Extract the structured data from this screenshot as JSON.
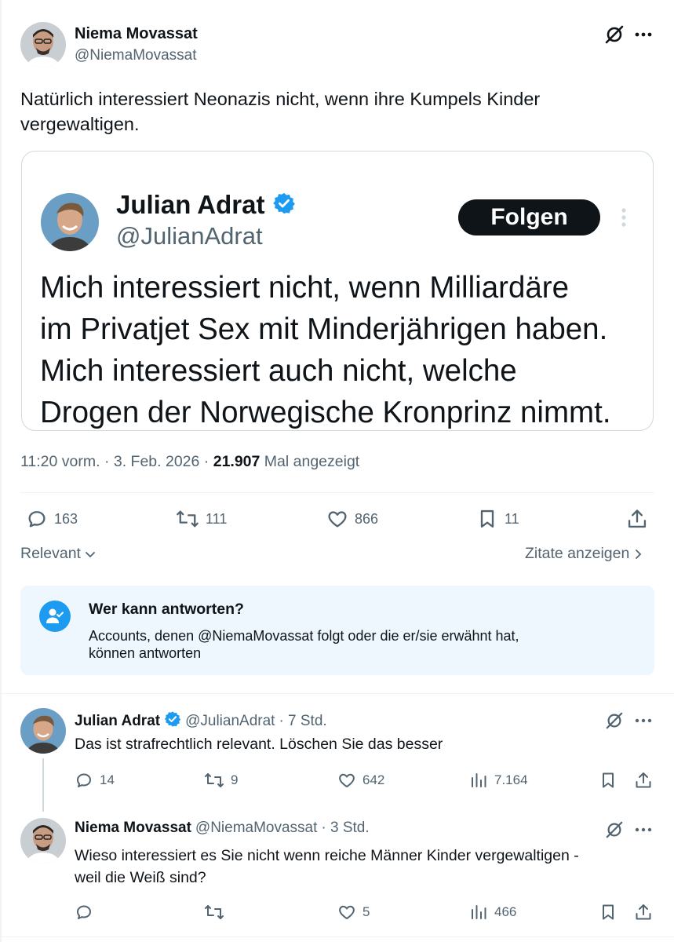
{
  "main_tweet": {
    "author_name": "Niema Movassat",
    "author_handle": "@NiemaMovassat",
    "text_line1": "Natürlich interessiert Neonazis nicht, wenn ihre Kumpels Kinder",
    "text_line2": "vergewaltigen.",
    "time": "11:20 vorm.",
    "date": "3. Feb. 2026",
    "views_count": "21.907",
    "views_label": "Mal angezeigt",
    "replies": "163",
    "retweets": "111",
    "likes": "866",
    "bookmarks": "11"
  },
  "quoted": {
    "author_name": "Julian Adrat",
    "author_handle": "@JulianAdrat",
    "follow_label": "Folgen",
    "line1": "Mich interessiert nicht, wenn Milliardäre",
    "line2": "im Privatjet Sex mit Minderjährigen haben.",
    "line3": "Mich interessiert auch nicht, welche",
    "line4": "Drogen der Norwegische Kronprinz nimmt."
  },
  "sort": {
    "relevant_label": "Relevant",
    "quotes_label": "Zitate anzeigen"
  },
  "reply_notice": {
    "title": "Wer kann antworten?",
    "line1": "Accounts, denen @NiemaMovassat folgt oder die er/sie erwähnt hat,",
    "line2": "können antworten"
  },
  "replies": [
    {
      "author_name": "Julian Adrat",
      "author_handle": "@JulianAdrat",
      "time_ago": "· 7 Std.",
      "text_line1": "Das ist strafrechtlich relevant. Löschen Sie das besser",
      "text_line2": "",
      "replies": "14",
      "retweets": "9",
      "likes": "642",
      "views": "7.164",
      "verified": true
    },
    {
      "author_name": "Niema Movassat",
      "author_handle": "@NiemaMovassat",
      "time_ago": "· 3 Std.",
      "text_line1": "Wieso interessiert es Sie nicht wenn reiche Männer Kinder vergewaltigen -",
      "text_line2": "weil die Weiß sind?",
      "replies": "",
      "retweets": "",
      "likes": "5",
      "views": "466",
      "verified": false
    }
  ],
  "colors": {
    "accent": "#1d9bf0",
    "text": "#0f1419",
    "muted": "#536471",
    "notice_bg": "#edf7fd"
  },
  "icons": [
    "grok-icon",
    "more-icon",
    "verified-badge-icon",
    "reply-icon",
    "retweet-icon",
    "like-icon",
    "bookmark-icon",
    "share-icon",
    "views-icon",
    "chevron-down-icon",
    "chevron-right-icon",
    "people-check-icon"
  ]
}
